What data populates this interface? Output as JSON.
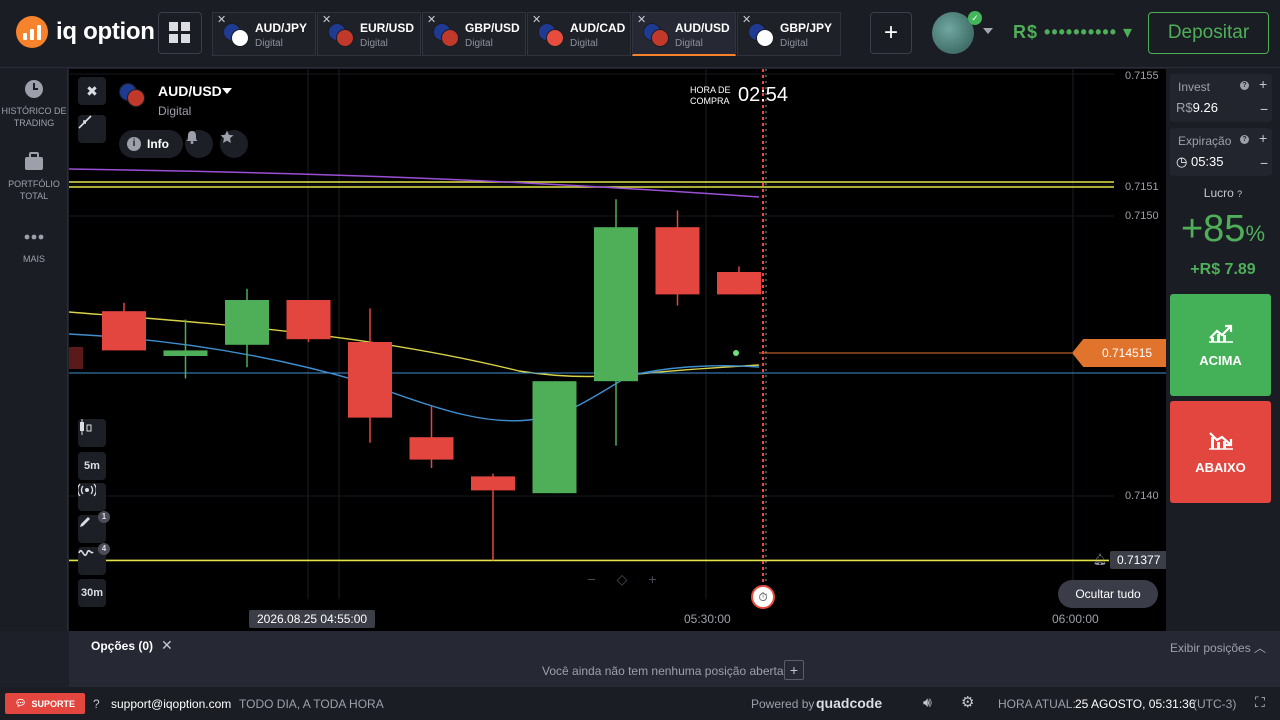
{
  "brand": {
    "name": "iq option",
    "accent": "#f6822c"
  },
  "tabs": [
    {
      "pair": "AUD/JPY",
      "type": "Digital",
      "flag_a": "#1f3a93",
      "flag_b": "#ffffff",
      "active": false
    },
    {
      "pair": "EUR/USD",
      "type": "Digital",
      "flag_a": "#1f3a93",
      "flag_b": "#c0392b",
      "active": false
    },
    {
      "pair": "GBP/USD",
      "type": "Digital",
      "flag_a": "#1f3a93",
      "flag_b": "#c0392b",
      "active": false
    },
    {
      "pair": "AUD/CAD",
      "type": "Digital",
      "flag_a": "#1f3a93",
      "flag_b": "#e74c3c",
      "active": false
    },
    {
      "pair": "AUD/USD",
      "type": "Digital",
      "flag_a": "#1f3a93",
      "flag_b": "#c0392b",
      "active": true
    },
    {
      "pair": "GBP/JPY",
      "type": "Digital",
      "flag_a": "#1f3a93",
      "flag_b": "#ffffff",
      "active": false
    }
  ],
  "header": {
    "balance": "R$ •••••••••• ▾",
    "deposit_label": "Depositar"
  },
  "leftnav": [
    {
      "label": "HISTÓRICO DE TRADING",
      "icon": "clock-icon"
    },
    {
      "label": "PORTFÓLIO TOTAL",
      "icon": "briefcase-icon"
    },
    {
      "label": "MAIS",
      "icon": "more-dots-icon"
    }
  ],
  "asset": {
    "name": "AUD/USD",
    "type": "Digital",
    "info_label": "Info"
  },
  "buy_time": {
    "label": "HORA DE COMPRA",
    "value": "02:54"
  },
  "chart_tools": {
    "timeframe": "5m",
    "interval": "30m",
    "drawing_count": "1",
    "indicator_count": "4"
  },
  "chart_data": {
    "type": "candlestick",
    "timeframe": "5m",
    "x_labels": [
      "2026.08.25 04:55:00",
      "05:30:00",
      "06:00:00"
    ],
    "y_ticks": [
      "0.7155",
      "0.7151",
      "0.7150",
      "0.7140"
    ],
    "current_price": "0.714515",
    "alert_level": "0.71377",
    "candles": [
      {
        "o": 0.71466,
        "h": 0.71469,
        "l": 0.71454,
        "c": 0.71452
      },
      {
        "o": 0.7145,
        "h": 0.71463,
        "l": 0.71442,
        "c": 0.71452
      },
      {
        "o": 0.71454,
        "h": 0.71474,
        "l": 0.71446,
        "c": 0.7147
      },
      {
        "o": 0.7147,
        "h": 0.7147,
        "l": 0.71455,
        "c": 0.71456
      },
      {
        "o": 0.71455,
        "h": 0.71467,
        "l": 0.71419,
        "c": 0.71428
      },
      {
        "o": 0.71421,
        "h": 0.71432,
        "l": 0.7141,
        "c": 0.71413
      },
      {
        "o": 0.71407,
        "h": 0.71408,
        "l": 0.71377,
        "c": 0.71402
      },
      {
        "o": 0.71401,
        "h": 0.71441,
        "l": 0.71401,
        "c": 0.71441
      },
      {
        "o": 0.71441,
        "h": 0.71506,
        "l": 0.71418,
        "c": 0.71496
      },
      {
        "o": 0.71496,
        "h": 0.71502,
        "l": 0.71468,
        "c": 0.71472
      },
      {
        "o": 0.7148,
        "h": 0.71482,
        "l": 0.71472,
        "c": 0.71472
      }
    ],
    "colors": {
      "up": "#4fae58",
      "down": "#e3463e"
    }
  },
  "trade": {
    "invest_label": "Invest",
    "invest_currency": "R$",
    "invest_value": "9.26",
    "expiry_label": "Expiração",
    "expiry_value": "05:35",
    "profit_label": "Lucro",
    "profit_pct": "+85",
    "profit_pct_sign": "%",
    "profit_amount": "+R$ 7.89",
    "up_label": "ACIMA",
    "down_label": "ABAIXO",
    "up_color": "#44b057",
    "down_color": "#e3463e"
  },
  "hide_all_label": "Ocultar tudo",
  "positions": {
    "title": "Opções (0)",
    "empty_text": "Você ainda não tem nenhuma posição aberta",
    "show_label": "Exibir posições"
  },
  "footer": {
    "support_label": "SUPORTE",
    "email": "support@iqoption.com",
    "hours": "TODO DIA, A TODA HORA",
    "powered_by": "Powered by",
    "powered_brand": "quadcode",
    "time_label": "HORA ATUAL:",
    "time_value": "25 AGOSTO, 05:31:36",
    "tz": "(UTC-3)"
  }
}
